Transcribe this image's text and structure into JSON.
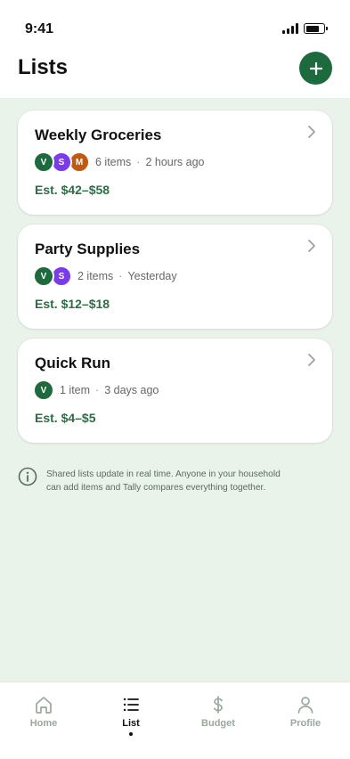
{
  "status_bar": {
    "time": "9:41"
  },
  "header": {
    "title": "Lists",
    "add_icon": "plus-icon"
  },
  "lists": [
    {
      "title": "Weekly Groceries",
      "members": [
        {
          "initial": "V",
          "color": "#1e6a3f"
        },
        {
          "initial": "S",
          "color": "#7c3aed"
        },
        {
          "initial": "M",
          "color": "#c2590f"
        }
      ],
      "item_count": "6 items",
      "updated": "2 hours ago",
      "estimate": "Est. $42–$58"
    },
    {
      "title": "Party Supplies",
      "members": [
        {
          "initial": "V",
          "color": "#1e6a3f"
        },
        {
          "initial": "S",
          "color": "#7c3aed"
        }
      ],
      "item_count": "2 items",
      "updated": "Yesterday",
      "estimate": "Est. $12–$18"
    },
    {
      "title": "Quick Run",
      "members": [
        {
          "initial": "V",
          "color": "#1e6a3f"
        }
      ],
      "item_count": "1 item",
      "updated": "3 days ago",
      "estimate": "Est. $4–$5"
    }
  ],
  "info": {
    "line1": "Shared lists update in real time. Anyone in your household",
    "line2": "can add items and Tally compares everything together."
  },
  "tabbar": {
    "tabs": [
      {
        "label": "Home",
        "icon": "home-icon",
        "active": false
      },
      {
        "label": "List",
        "icon": "list-icon",
        "active": true
      },
      {
        "label": "Budget",
        "icon": "dollar-icon",
        "active": false
      },
      {
        "label": "Profile",
        "icon": "person-icon",
        "active": false
      }
    ]
  },
  "colors": {
    "accent": "#1e6a3f",
    "background": "#eaf3ea",
    "estimate": "#2a6e43"
  }
}
